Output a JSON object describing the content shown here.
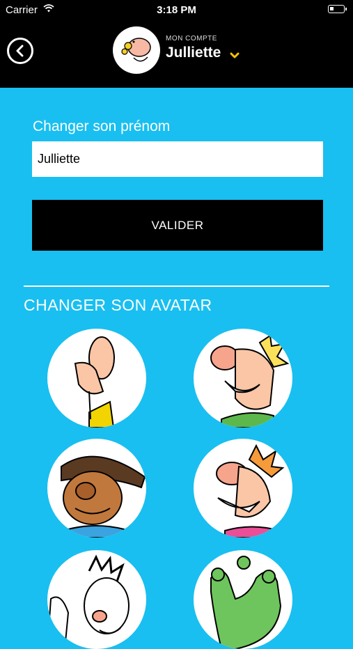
{
  "status_bar": {
    "carrier": "Carrier",
    "time": "3:18 PM"
  },
  "header": {
    "account_label": "MON COMPTE",
    "account_name": "Julliette",
    "back_icon": "back-arrow-circle-icon",
    "dropdown_icon": "chevron-down-icon",
    "accent_color": "#f5c400"
  },
  "form": {
    "name_label": "Changer son prénom",
    "name_value": "Julliette",
    "submit_label": "VALIDER"
  },
  "avatar_section": {
    "title": "CHANGER SON AVATAR",
    "avatars": [
      "avatar-bignose-yellow-shirt",
      "avatar-blond-green-shirt",
      "avatar-dark-hair",
      "avatar-orange-hair-pink-shirt",
      "avatar-spiky-hair",
      "avatar-green-monster"
    ]
  },
  "colors": {
    "background": "#19bff0",
    "header_bg": "#000000",
    "button_bg": "#000000"
  }
}
